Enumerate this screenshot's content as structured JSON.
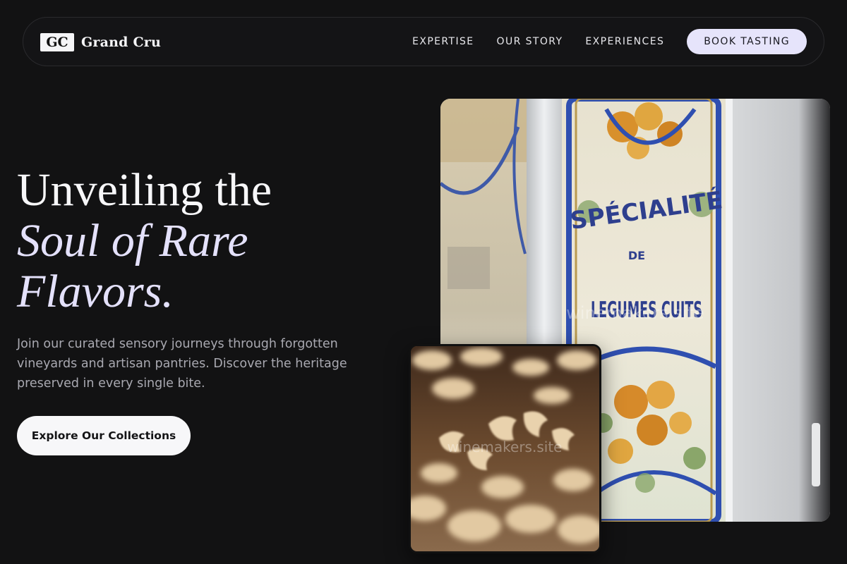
{
  "nav": {
    "brand_mark": "GC",
    "brand_name": "Grand Cru",
    "links": [
      {
        "label": "EXPERTISE"
      },
      {
        "label": "OUR STORY"
      },
      {
        "label": "EXPERIENCES"
      }
    ],
    "cta_label": "BOOK TASTING"
  },
  "hero": {
    "title_line1": "Unveiling the",
    "title_line2": "Soul of Rare",
    "title_line3": "Flavors.",
    "body": "Join our curated sensory journeys through forgotten vineyards and artisan pantries. Discover the heritage preserved in every single bite.",
    "button_label": "Explore Our Collections"
  },
  "images": {
    "main": {
      "sign_line1": "SPÉCIALITÉ",
      "sign_line2": "DE",
      "sign_line3": "LEGUMES CUITS",
      "watermark": "winemakers.site"
    },
    "small": {
      "watermark": "winemakers.site"
    }
  },
  "colors": {
    "background": "#121213",
    "accent": "#e6e4fb",
    "text_muted": "#a9a9b1"
  }
}
